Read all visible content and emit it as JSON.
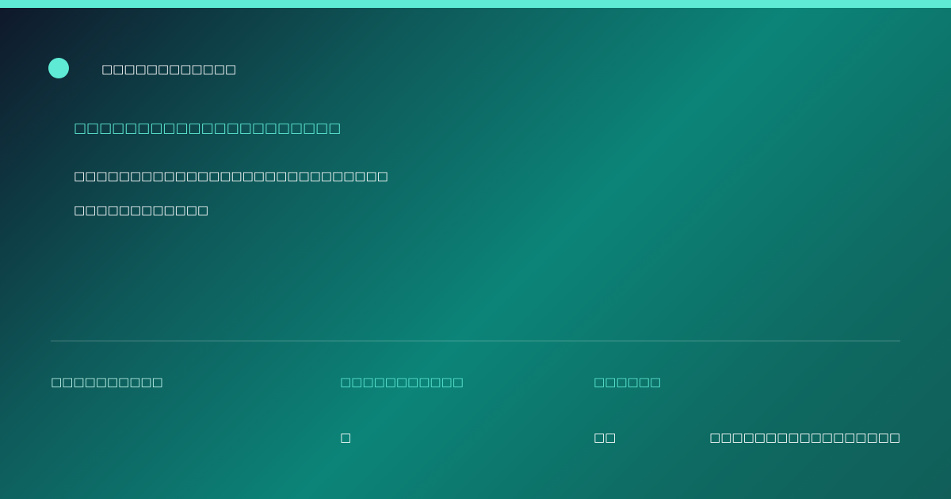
{
  "colors": {
    "accent": "#5eead4",
    "text": "#ffffff"
  },
  "header": {
    "brand": "□□□□□□□□□□□□"
  },
  "hero": {
    "headline": "□□□□□□□□□□□□□□□□□□□□□",
    "description_line1": "□□□□□□□□□□□□□□□□□□□□□□□□□□□□",
    "description_line2": "□□□□□□□□□□□□"
  },
  "footer": {
    "col1_label": "□□□□□□□□□□",
    "col2_label": "□□□□□□□□□□□",
    "col2_value": "□",
    "col3_label": "□□□□□□",
    "col3_value": "□□",
    "col4_value": "□□□□□□□□□□□□□□□□□"
  }
}
